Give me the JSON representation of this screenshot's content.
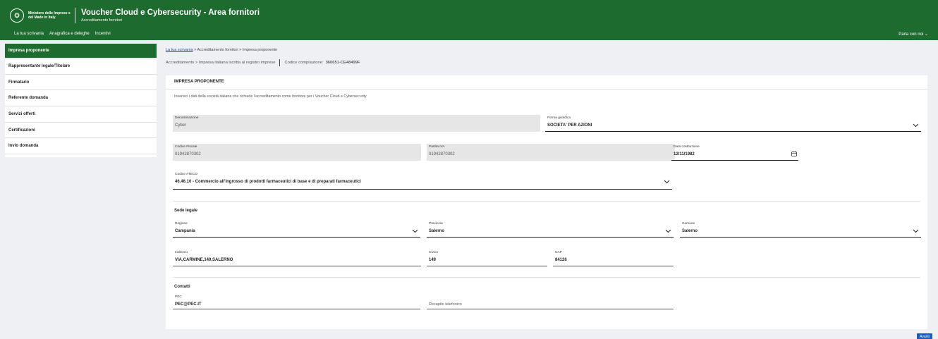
{
  "header": {
    "ministry": "Ministero delle Imprese e del Made in Italy",
    "title": "Voucher Cloud e Cybersecurity - Area fornitori",
    "subtitle": "Accreditamento fornitori",
    "nav": [
      "La tua scrivania",
      "Anagrafica e deleghe",
      "Incentivi"
    ],
    "parla": "Parla con noi",
    "brand_color": "#1e6b2f",
    "emblem_icon": "italy-emblem-icon"
  },
  "sidebar": {
    "items": [
      {
        "label": "Impresa proponente",
        "active": true
      },
      {
        "label": "Rappresentante legale/Titolare"
      },
      {
        "label": "Firmatario"
      },
      {
        "label": "Referente domanda"
      },
      {
        "label": "Servizi offerti"
      },
      {
        "label": "Certificazioni"
      },
      {
        "label": "Invio domanda"
      }
    ]
  },
  "breadcrumb": {
    "home": "La tua scrivania",
    "sep": ">",
    "items": [
      "Accreditamento fornitori",
      "Impresa proponente"
    ]
  },
  "subbar": {
    "path": "Accreditamento > Impresa italiana iscritta al registro imprese",
    "code_label": "Codice compilazione:",
    "code": "360651-CE48499F"
  },
  "card": {
    "title": "IMPRESA PROPONENTE",
    "intro": "Inserisci i dati della società italiana che richiede l'accreditamento come fornitore per i Voucher Cloud e Cybersecurity"
  },
  "fields": {
    "denominazione": {
      "label": "Denominazione",
      "value": "Cyber"
    },
    "forma_giuridica": {
      "label": "Forma giuridica",
      "value": "SOCIETA' PER AZIONI"
    },
    "codice_fiscale": {
      "label": "Codice Fiscale",
      "value": "01942870302"
    },
    "partita_iva": {
      "label": "Partita IVA",
      "value": "01942870302"
    },
    "data_costituzione": {
      "label": "Data costituzione",
      "value": "12/11/1982"
    },
    "codice_ateco": {
      "label": "Codice ATECO",
      "value": "46.46.10 - Commercio all'ingrosso di prodotti farmaceutici di base e di preparati farmaceutici"
    }
  },
  "sede": {
    "title": "Sede legale",
    "regione": {
      "label": "Regione",
      "value": "Campania"
    },
    "provincia": {
      "label": "Provincia",
      "value": "Salerno"
    },
    "comune": {
      "label": "Comune",
      "value": "Salerno"
    },
    "indirizzo": {
      "label": "Indirizzo",
      "value": "VIA,CARMINE,149,SALERNO"
    },
    "civico": {
      "label": "Civico",
      "value": "149"
    },
    "cap": {
      "label": "CAP",
      "value": "84126"
    }
  },
  "contatti": {
    "title": "Contatti",
    "pec": {
      "label": "PEC",
      "value": "PEC@PEC.IT"
    },
    "recapito": {
      "label": "Recapito telefonico",
      "value": ""
    }
  },
  "next_button": "Avanti"
}
